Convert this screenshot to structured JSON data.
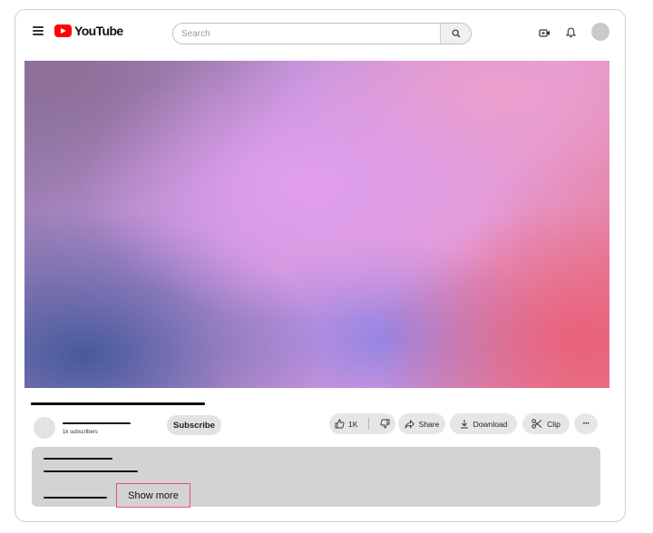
{
  "header": {
    "logo_text": "YouTube",
    "search_placeholder": "Search"
  },
  "video": {
    "gradient_colors": [
      "#8f78a8",
      "#e4a0f0",
      "#e8788c",
      "#465a9b",
      "#8c82e6"
    ]
  },
  "channel": {
    "subscribers": "1k subscribers",
    "subscribe_label": "Subscribe"
  },
  "actions": {
    "like_count": "1K",
    "share_label": "Share",
    "download_label": "Download",
    "clip_label": "Clip",
    "more_label": "···"
  },
  "description": {
    "show_more_label": "Show more",
    "highlight_color": "#e0566b"
  },
  "colors": {
    "brand": "#ff0000",
    "pill_bg": "#e6e6e6",
    "description_bg": "#d3d3d3"
  }
}
